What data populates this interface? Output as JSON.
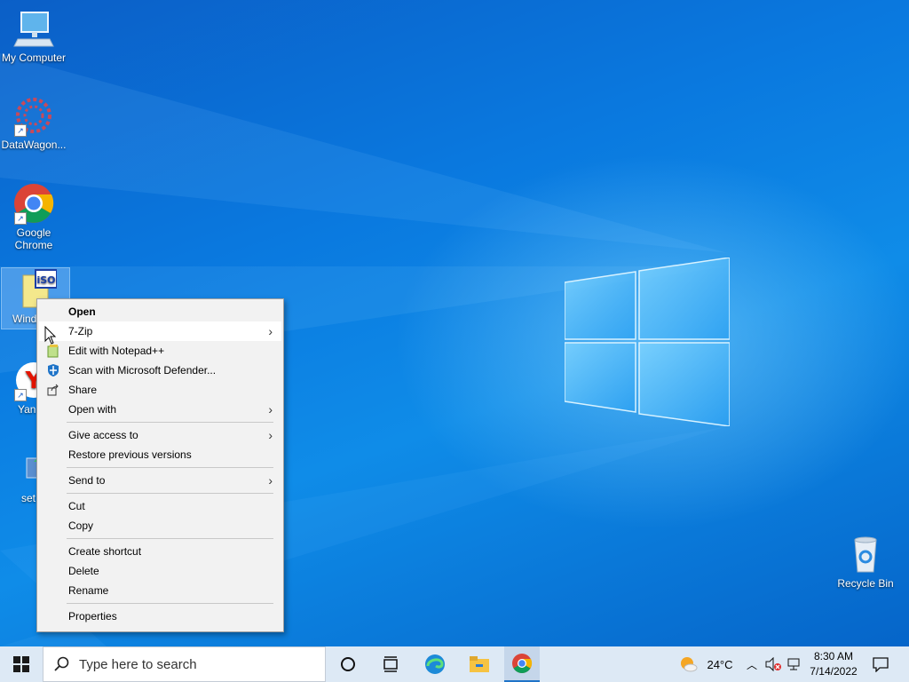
{
  "desktop": {
    "icons": [
      {
        "label": "My Computer",
        "icon": "computer-icon"
      },
      {
        "label": "DataWagon...",
        "icon": "datawagon-icon"
      },
      {
        "label": "Google Chrome",
        "icon": "chrome-icon"
      },
      {
        "label": "Wind",
        "icon": "iso-file-icon"
      },
      {
        "label": "Yan",
        "icon": "yandex-icon"
      },
      {
        "label": "set",
        "icon": "setup-icon"
      },
      {
        "label": "Recycle Bin",
        "icon": "recycle-bin-icon"
      }
    ]
  },
  "context_menu": {
    "items": [
      {
        "label": "Open",
        "bold": true
      },
      {
        "label": "7-Zip",
        "submenu": true,
        "hover": true
      },
      {
        "label": "Edit with Notepad++",
        "icon": "notepadpp-icon"
      },
      {
        "label": "Scan with Microsoft Defender...",
        "icon": "defender-icon"
      },
      {
        "label": "Share",
        "icon": "share-icon"
      },
      {
        "label": "Open with",
        "submenu": true
      },
      {
        "label": "Give access to",
        "submenu": true
      },
      {
        "label": "Restore previous versions"
      },
      {
        "label": "Send to",
        "submenu": true
      },
      {
        "label": "Cut"
      },
      {
        "label": "Copy"
      },
      {
        "label": "Create shortcut"
      },
      {
        "label": "Delete"
      },
      {
        "label": "Rename"
      },
      {
        "label": "Properties"
      }
    ]
  },
  "taskbar": {
    "search_placeholder": "Type here to search",
    "weather": "24°C",
    "time": "8:30 AM",
    "date": "7/14/2022",
    "pinned": [
      "task-view-icon",
      "widgets-icon",
      "edge-icon",
      "file-explorer-icon",
      "chrome-icon"
    ]
  },
  "colors": {
    "desktop_blue": "#0a79df",
    "taskbar_bg": "#dde9f5",
    "menu_bg": "#f2f2f2"
  }
}
